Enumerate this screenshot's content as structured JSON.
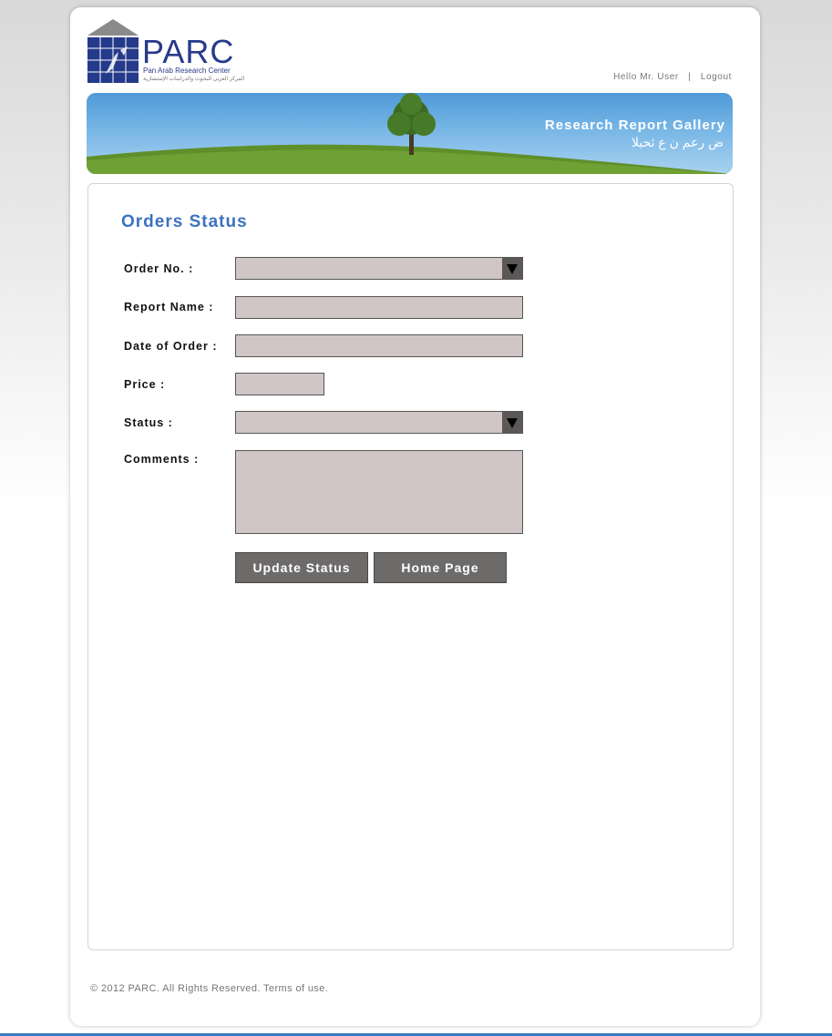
{
  "header": {
    "logo_text": "PARC",
    "logo_subtitle": "Pan Arab Research Center",
    "logo_arabic": "المركز العربي للبحوث والدراسات الإستشارية",
    "greeting": "Hello Mr. User",
    "separator": "|",
    "logout_label": "Logout"
  },
  "banner": {
    "title": "Research Report Gallery",
    "arabic_title": "ض رعم ن ع ثحبلا"
  },
  "form": {
    "heading": "Orders Status",
    "order_no_label": "Order No. :",
    "report_name_label": "Report Name :",
    "date_label": "Date of Order :",
    "price_label": "Price :",
    "status_label": "Status :",
    "comments_label": "Comments :",
    "order_no_value": "",
    "report_name_value": "",
    "date_value": "",
    "price_value": "",
    "status_value": "",
    "comments_value": "",
    "update_button": "Update Status",
    "home_button": "Home Page"
  },
  "footer": {
    "copyright": "© 2012 PARC. All Rights Reserved. Terms of use."
  },
  "colors": {
    "heading": "#3c72c0",
    "field_bg": "#d1c6c6",
    "button_bg": "#6d6a6a",
    "brand": "#273a8c"
  }
}
